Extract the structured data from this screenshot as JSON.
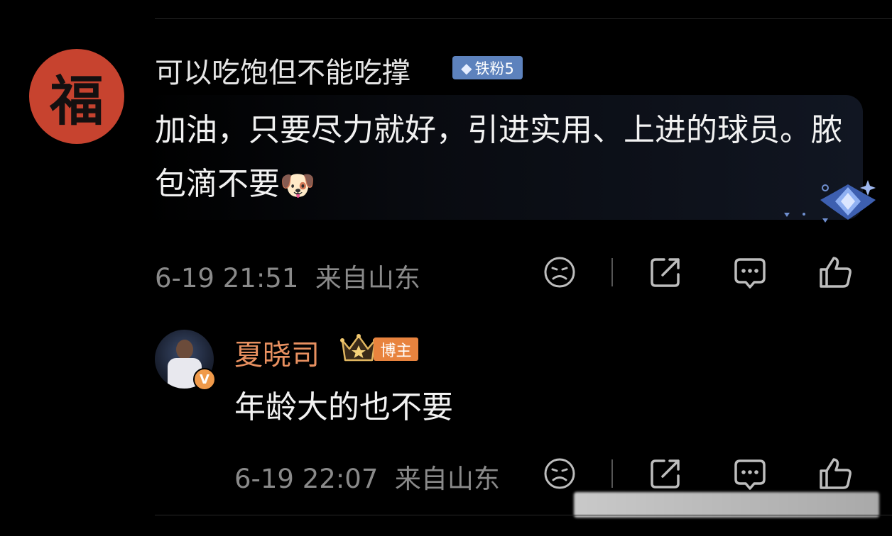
{
  "comment": {
    "avatar_char": "福",
    "username": "可以吃饱但不能吃撑",
    "fan_badge": "铁粉5",
    "text": "加油，只要尽力就好，引进实用、上进的球员。脓包滴不要",
    "emoji": "🐶",
    "time": "6-19 21:51",
    "location": "来自山东"
  },
  "reply": {
    "username": "夏晓司",
    "badge": "博主",
    "verified_mark": "V",
    "text": "年龄大的也不要",
    "time": "6-19 22:07",
    "location": "来自山东"
  },
  "icons": {
    "dislike": "sad-face-icon",
    "share": "share-icon",
    "reply": "comment-icon",
    "like": "thumbs-up-icon"
  },
  "colors": {
    "background": "#000000",
    "fan_badge": "#5d82bd",
    "host_badge": "#e8833e",
    "reply_username": "#e89060",
    "meta_text": "#8a8a8a"
  }
}
